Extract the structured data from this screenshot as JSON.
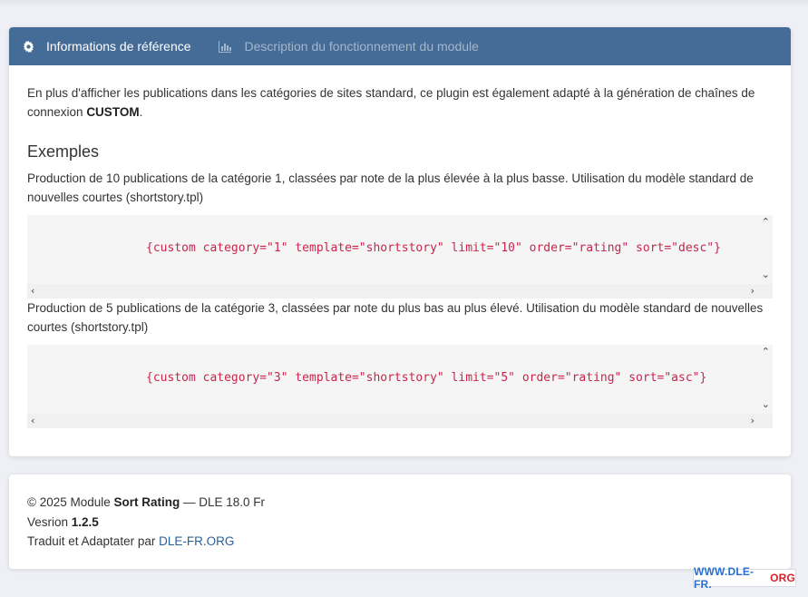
{
  "tabs": [
    {
      "label": "Informations de référence",
      "icon": "gear-icon"
    },
    {
      "label": "Description du fonctionnement du module",
      "icon": "bar-chart-icon"
    }
  ],
  "intro": {
    "text_before": "En plus d'afficher les publications dans les catégories de sites standard, ce plugin est également adapté à la génération de chaînes de connexion ",
    "bold": "CUSTOM",
    "text_after": "."
  },
  "examples": {
    "heading": "Exemples",
    "items": [
      {
        "description": "Production de 10 publications de la catégorie 1, classées par note de la plus élevée à la plus basse. Utilisation du modèle standard de nouvelles courtes (shortstory.tpl)",
        "code": "{custom category=\"1\" template=\"shortstory\" limit=\"10\" order=\"rating\" sort=\"desc\"}"
      },
      {
        "description": "Production de 5 publications de la catégorie 3, classées par note du plus bas au plus élevé. Utilisation du modèle standard de nouvelles courtes (shortstory.tpl)",
        "code": "{custom category=\"3\" template=\"shortstory\" limit=\"5\" order=\"rating\" sort=\"asc\"}"
      }
    ]
  },
  "footer": {
    "copyright_prefix": "© 2025 Module ",
    "module_name": "Sort Rating",
    "copyright_suffix": " — DLE 18.0 Fr",
    "version_label": "Vesrion ",
    "version": "1.2.5",
    "credit_prefix": "Traduit et Adaptater par ",
    "credit_link": "DLE-FR.ORG"
  },
  "watermark": {
    "part1": "WWW.DLE-FR.",
    "part2": "ORG"
  },
  "colors": {
    "header": "#456b97",
    "code": "#c7254e",
    "link": "#2a5f9a"
  }
}
